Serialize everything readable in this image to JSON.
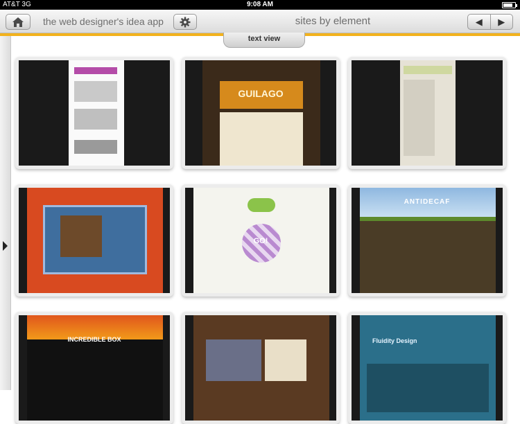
{
  "status_bar": {
    "carrier": "AT&T",
    "network": "3G",
    "time": "9:08 AM",
    "battery_level": 0.8
  },
  "nav": {
    "app_name": "the web designer's idea app",
    "section_title": "sites by element",
    "home_icon": "home-icon",
    "settings_icon": "gear-icon",
    "prev_icon": "left-arrow-icon",
    "next_icon": "right-arrow-icon"
  },
  "view_tab": {
    "label": "text view"
  },
  "colors": {
    "accent": "#f2b21d"
  },
  "thumbnails": [
    {
      "caption": "",
      "theme": "#ffffff"
    },
    {
      "caption": "GUILAGO",
      "theme": "#3b2a1a"
    },
    {
      "caption": "",
      "theme": "#e6e2d6"
    },
    {
      "caption": "",
      "theme": "#d84a20"
    },
    {
      "caption": "GO!",
      "theme": "#f4f4ee"
    },
    {
      "caption": "ANTIDECAF",
      "theme": "#4a3c26"
    },
    {
      "caption": "INCREDIBLE BOX",
      "theme": "#111111"
    },
    {
      "caption": "",
      "theme": "#5a3a22"
    },
    {
      "caption": "Fluidity Design",
      "theme": "#2b6f8a"
    }
  ]
}
